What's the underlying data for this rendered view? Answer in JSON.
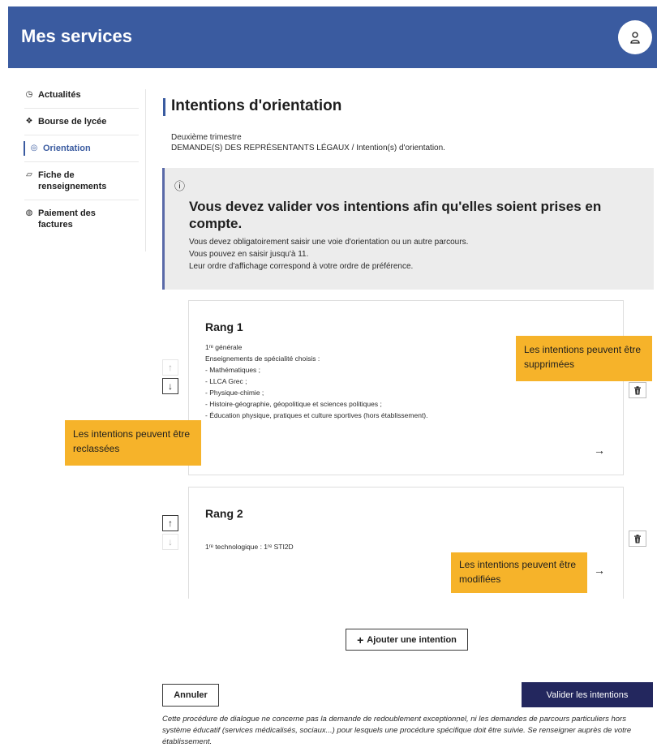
{
  "header": {
    "title": "Mes services",
    "avatar_icon": "user-icon"
  },
  "sidebar": {
    "items": [
      {
        "label": "Actualités",
        "icon": "clock-icon"
      },
      {
        "label": "Bourse de lycée",
        "icon": "coins-icon"
      },
      {
        "label": "Orientation",
        "icon": "compass-icon",
        "active": true
      },
      {
        "label": "Fiche de renseignements",
        "icon": "form-icon"
      },
      {
        "label": "Paiement des factures",
        "icon": "payment-icon"
      }
    ]
  },
  "page": {
    "title": "Intentions d'orientation",
    "breadcrumb": {
      "line1": "Deuxième trimestre",
      "line2": "DEMANDE(S) DES REPRÉSENTANTS LÉGAUX / Intention(s) d'orientation."
    }
  },
  "alert": {
    "icon": "info-icon",
    "title": "Vous devez valider vos intentions afin qu'elles soient prises en compte.",
    "lines": [
      "Vous devez obligatoirement saisir une voie d'orientation ou un autre parcours.",
      "Vous pouvez en saisir jusqu'à 11.",
      "Leur ordre d'affichage correspond à votre ordre de préférence."
    ]
  },
  "intentions": [
    {
      "title": "Rang 1",
      "lines": [
        "1ʳᵉ générale",
        "Enseignements de spécialité choisis :",
        "- Mathématiques ;",
        "- LLCA Grec ;",
        "- Physique-chimie ;",
        "- Histoire-géographie, géopolitique et sciences politiques ;",
        "- Éducation physique, pratiques et culture sportives (hors établissement)."
      ]
    },
    {
      "title": "Rang 2",
      "lines": [
        "1ʳᵉ technologique : 1ʳᵉ STI2D"
      ]
    }
  ],
  "controls": {
    "up_symbol": "↑",
    "down_symbol": "↓",
    "open_symbol": "→"
  },
  "callouts": {
    "delete": "Les intentions peuvent être supprimées",
    "reorder": "Les intentions peuvent être reclassées",
    "modify": "Les intentions peuvent être modifiées"
  },
  "actions": {
    "add_symbol": "+",
    "add_label": "Ajouter une intention",
    "cancel_label": "Annuler",
    "validate_label": "Valider les intentions"
  },
  "footnote": "Cette procédure de dialogue ne concerne pas la demande de redoublement exceptionnel, ni les demandes de parcours particuliers hors système éducatif (services médicalisés, sociaux...) pour lesquels une procédure spécifique doit être suivie. Se renseigner auprès de votre établissement.",
  "colors": {
    "header": "#3a5ba0",
    "primary_button": "#23275e",
    "callout": "#f6b32a",
    "alert_background": "#ececec"
  }
}
